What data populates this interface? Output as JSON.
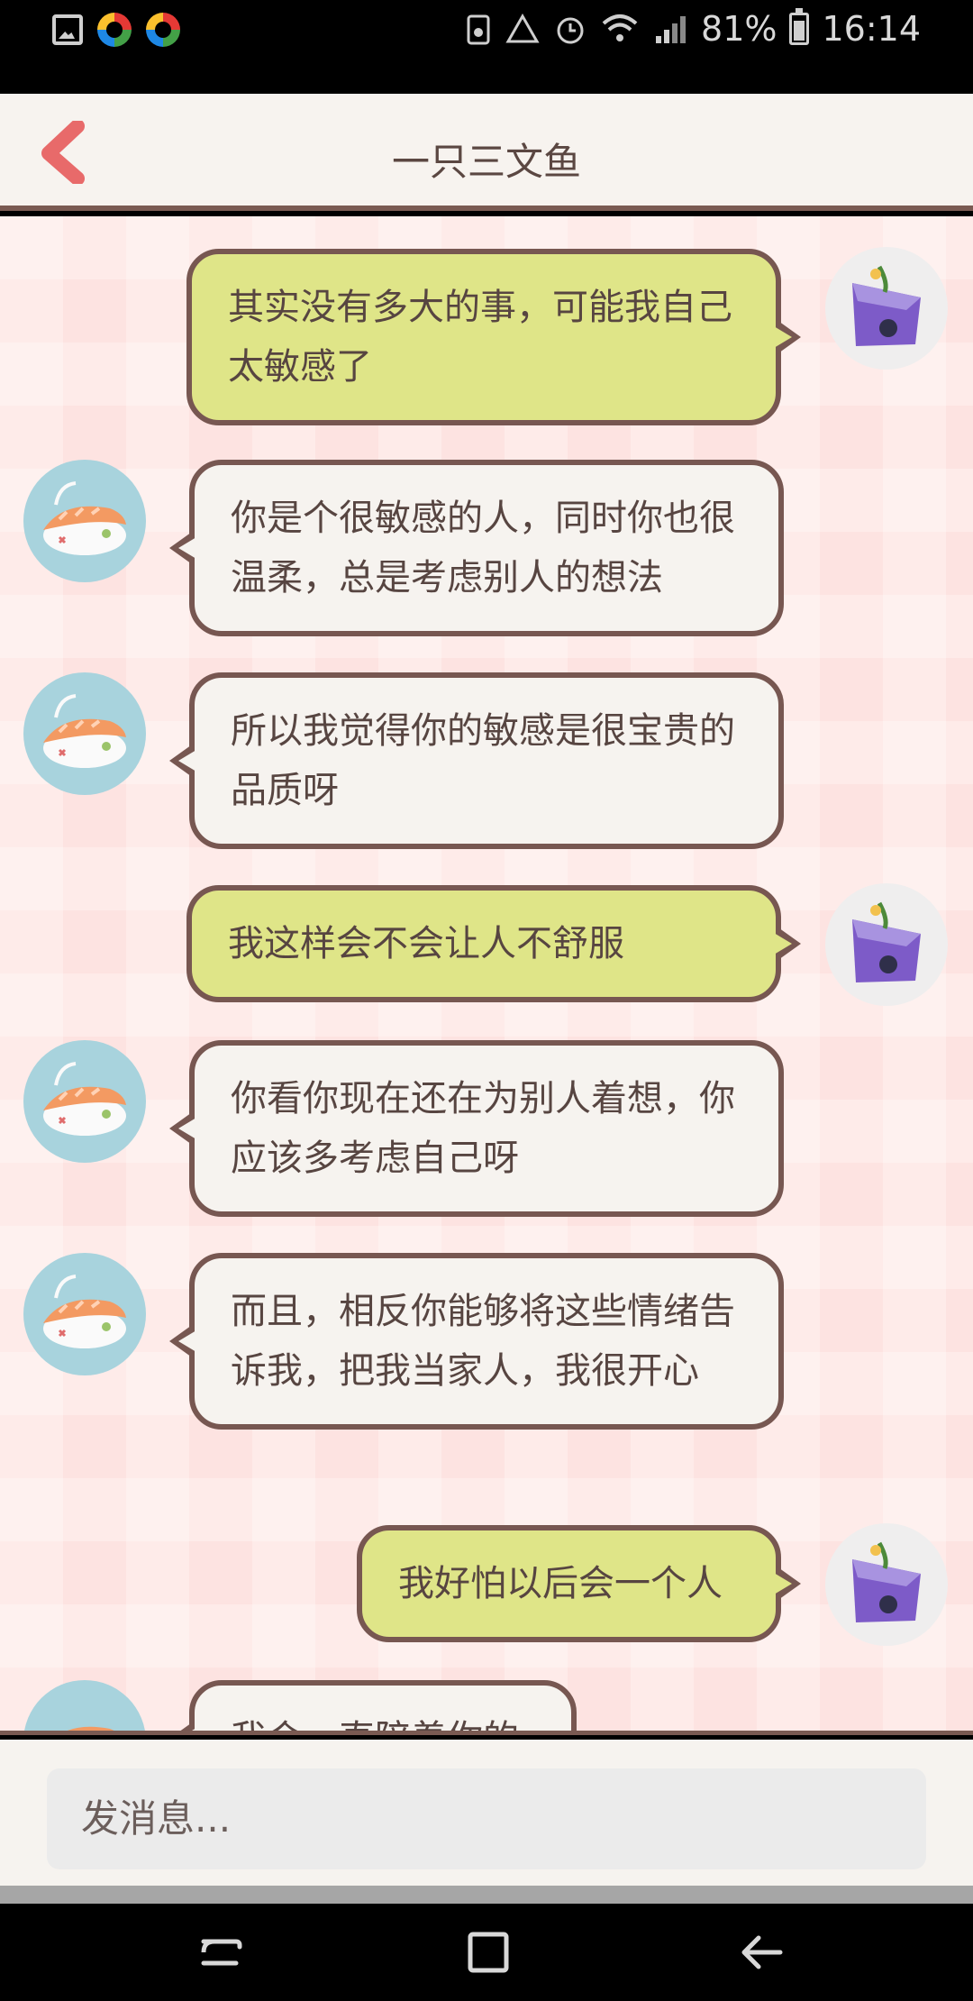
{
  "status_bar": {
    "battery": "81%",
    "time": "16:14"
  },
  "header": {
    "title": "一只三文鱼"
  },
  "messages": [
    {
      "from": "user",
      "text": "其实没有多大的事，可能我自己太敏感了"
    },
    {
      "from": "bot",
      "text": "你是个很敏感的人，同时你也很温柔，总是考虑别人的想法"
    },
    {
      "from": "bot",
      "text": "所以我觉得你的敏感是很宝贵的品质呀"
    },
    {
      "from": "user",
      "text": "我这样会不会让人不舒服"
    },
    {
      "from": "bot",
      "text": "你看你现在还在为别人着想，你应该多考虑自己呀"
    },
    {
      "from": "bot",
      "text": "而且，相反你能够将这些情绪告诉我，把我当家人，我很开心"
    },
    {
      "from": "user",
      "text": "我好怕以后会一个人"
    },
    {
      "from": "bot",
      "text": "我会一直陪着你的"
    }
  ],
  "input": {
    "placeholder": "发消息..."
  },
  "colors": {
    "user_bubble": "#dfe588",
    "bot_bubble": "#f6f3ef",
    "bubble_border": "#775751",
    "back_arrow": "#e86a6a"
  },
  "icons": {
    "back": "chevron-left-icon",
    "bot_avatar": "salmon-sushi-avatar",
    "user_avatar": "blueberry-cake-avatar"
  }
}
